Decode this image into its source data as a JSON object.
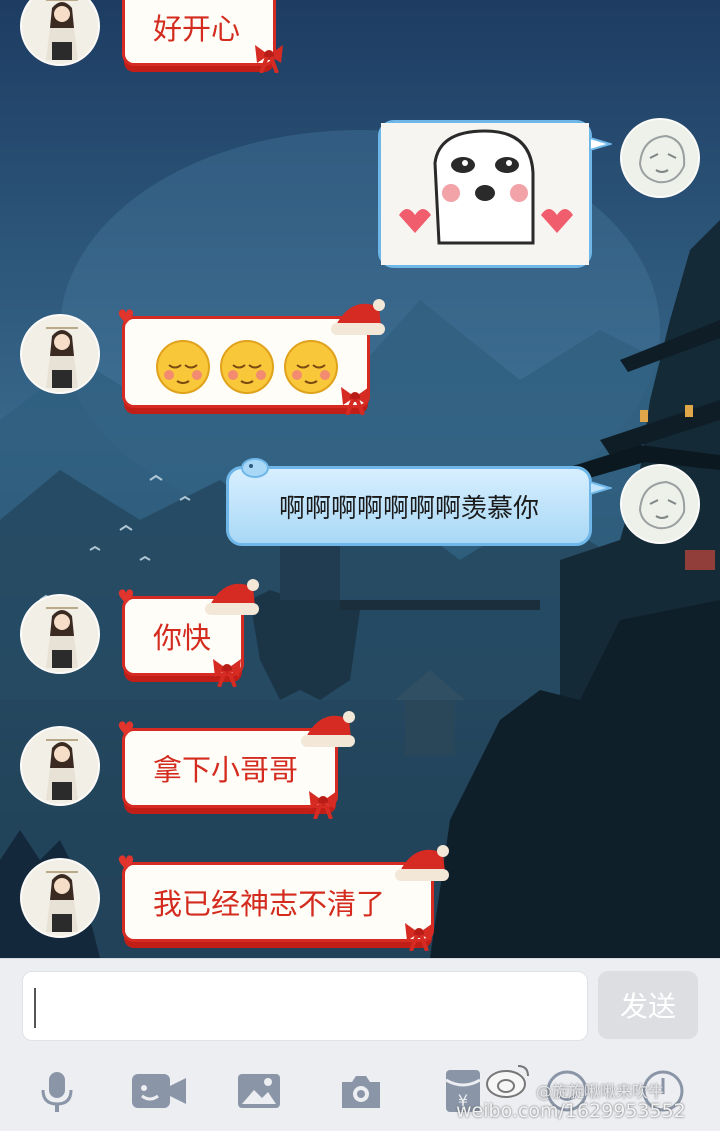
{
  "messages": [
    {
      "side": "incoming",
      "text": "好开心"
    },
    {
      "side": "outgoing",
      "type": "sticker",
      "sticker": "blushing-face-hearts-sticker"
    },
    {
      "side": "incoming",
      "type": "emoji",
      "emoji": [
        "😌",
        "😌",
        "😌"
      ]
    },
    {
      "side": "outgoing",
      "text": "啊啊啊啊啊啊啊羡慕你"
    },
    {
      "side": "incoming",
      "text": "你快"
    },
    {
      "side": "incoming",
      "text": "拿下小哥哥"
    },
    {
      "side": "incoming",
      "text": "我已经神志不清了"
    }
  ],
  "input": {
    "value": "",
    "send_label": "发送"
  },
  "toolbar": [
    "microphone-icon",
    "video-call-icon",
    "image-icon",
    "camera-icon",
    "red-packet-icon",
    "emoji-icon",
    "more-icon"
  ],
  "watermark": {
    "line1": "@旋旋啾啾来吹牛",
    "line2": "weibo.com/1629953552"
  },
  "colors": {
    "incoming_border": "#d62b23",
    "incoming_text": "#d32b1e",
    "outgoing_bg": "#a9d8f6",
    "send_disabled": "#dcdee2"
  }
}
